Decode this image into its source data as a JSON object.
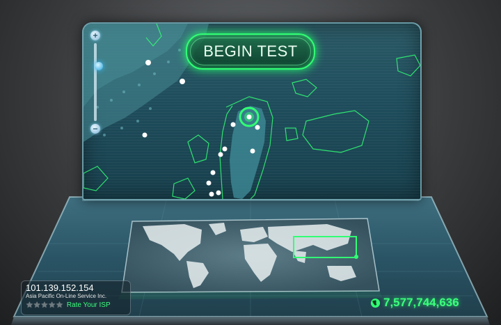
{
  "begin_button": {
    "label": "BEGIN TEST"
  },
  "zoom": {
    "plus_label": "+",
    "minus_label": "−",
    "level": 0.27
  },
  "connection": {
    "ip": "101.139.152.154",
    "isp": "Asia Pacific On-Line Service Inc.",
    "rating_stars": 0,
    "rate_label": "Rate Your ISP"
  },
  "tests_counter": "7,577,744,636",
  "colors": {
    "accent_green": "#31ff74",
    "map_water": "#1f4d5c",
    "zoom_knob": "#27a3e0"
  },
  "icons": [
    "plus-icon",
    "minus-icon",
    "globe-icon",
    "star-icon"
  ]
}
